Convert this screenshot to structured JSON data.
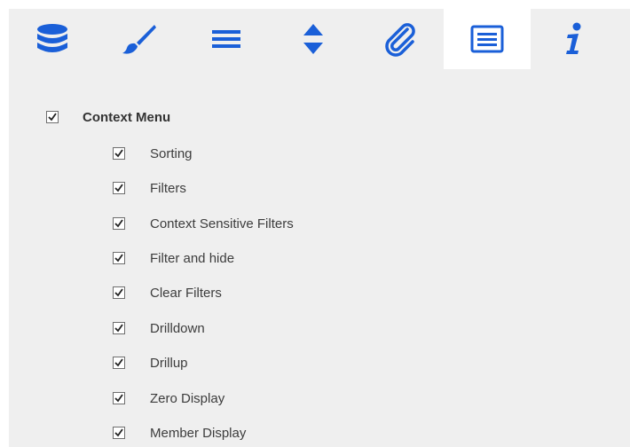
{
  "accent_color": "#1a5fd8",
  "toolbar": {
    "tabs": [
      {
        "icon": "database-icon",
        "active": false
      },
      {
        "icon": "brush-icon",
        "active": false
      },
      {
        "icon": "menu-lines-icon",
        "active": false
      },
      {
        "icon": "sort-arrows-icon",
        "active": false
      },
      {
        "icon": "paperclip-icon",
        "active": false
      },
      {
        "icon": "context-menu-list-icon",
        "active": true
      },
      {
        "icon": "info-icon",
        "active": false
      }
    ]
  },
  "context_menu": {
    "label": "Context Menu",
    "checked": true,
    "items": [
      {
        "label": "Sorting",
        "checked": true
      },
      {
        "label": "Filters",
        "checked": true
      },
      {
        "label": "Context Sensitive Filters",
        "checked": true
      },
      {
        "label": "Filter and hide",
        "checked": true
      },
      {
        "label": "Clear Filters",
        "checked": true
      },
      {
        "label": "Drilldown",
        "checked": true
      },
      {
        "label": "Drillup",
        "checked": true
      },
      {
        "label": "Zero Display",
        "checked": true
      },
      {
        "label": "Member Display",
        "checked": true
      }
    ]
  }
}
